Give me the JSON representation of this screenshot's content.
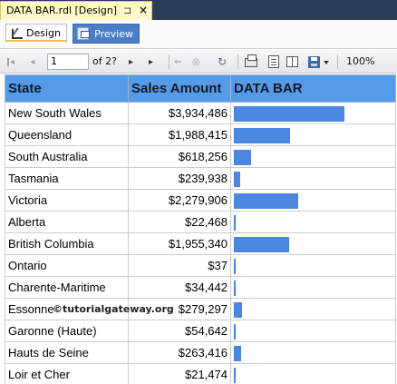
{
  "document_tab": {
    "title": "DATA BAR.rdl [Design]",
    "pin_glyph": "⊐",
    "close_glyph": "×"
  },
  "view_tabs": [
    {
      "label": "Design",
      "icon": "design-icon",
      "active": true
    },
    {
      "label": "Preview",
      "icon": "preview-icon",
      "active": false
    }
  ],
  "toolbar": {
    "page_value": "1",
    "page_of": "of 2?",
    "zoom": "100%",
    "first_glyph": "◂",
    "prev_glyph": "◂",
    "next_glyph": "▸",
    "last_glyph": "▸",
    "back_glyph": "⇐",
    "stop_glyph": "◎",
    "refresh_glyph": "↻"
  },
  "report": {
    "columns": [
      "State",
      "Sales Amount",
      "DATA BAR"
    ],
    "bar_color": "#4b86df",
    "header_color": "#559be8",
    "rows": [
      {
        "state": "New South Wales",
        "amount": "$3,934,486",
        "value": 3934486
      },
      {
        "state": "Queensland",
        "amount": "$1,988,415",
        "value": 1988415
      },
      {
        "state": "South Australia",
        "amount": "$618,256",
        "value": 618256
      },
      {
        "state": "Tasmania",
        "amount": "$239,938",
        "value": 239938
      },
      {
        "state": "Victoria",
        "amount": "$2,279,906",
        "value": 2279906
      },
      {
        "state": "Alberta",
        "amount": "$22,468",
        "value": 22468
      },
      {
        "state": "British Columbia",
        "amount": "$1,955,340",
        "value": 1955340
      },
      {
        "state": "Ontario",
        "amount": "$37",
        "value": 37
      },
      {
        "state": "Charente-Maritime",
        "amount": "$34,442",
        "value": 34442
      },
      {
        "state": "Essonne",
        "amount": "$279,297",
        "value": 279297
      },
      {
        "state": "Garonne (Haute)",
        "amount": "$54,642",
        "value": 54642
      },
      {
        "state": "Hauts de Seine",
        "amount": "$263,416",
        "value": 263416
      },
      {
        "state": "Loir et Cher",
        "amount": "$21,474",
        "value": 21474
      }
    ]
  },
  "watermark": "©tutorialgateway.org"
}
